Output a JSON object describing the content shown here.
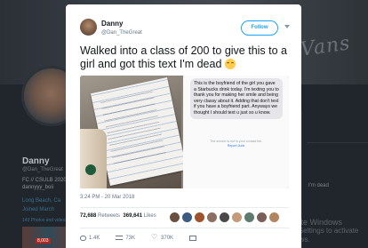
{
  "background_profile": {
    "banner_text": "Vans",
    "name": "Danny",
    "handle": "@Dan_TheGreat",
    "bio": "FC // CSULB 2020 dannyyy_boii",
    "location": "Long Beach, Ca",
    "joined": "Joined March",
    "photos_label": "143 Photos and videos",
    "thumb_badge": "8,003",
    "right_snippet": "I'm dead"
  },
  "watermark": {
    "line1": "Activate Windows",
    "line2": "Go to Settings to activate Windows."
  },
  "tweet": {
    "author_name": "Danny",
    "author_handle": "@Dan_TheGreat",
    "follow_label": "Follow",
    "text": "Walked into a class of 200 to give this to a girl and got this text I'm dead",
    "sms_message": "This is the boyfriend of the girl you gave a Starbucks drink today. I'm texting you to thank you for making her smile and being very classy about it. Adding that don't text if you have a boyfriend part. Anyways we thought I should text u just so u know.",
    "sms_footer": "The sender is not in your contact list.",
    "sms_link": "Report Junk",
    "timestamp": "3:24 PM - 20 Mar 2018",
    "retweets_count": "72,688",
    "retweets_label": "Retweets",
    "likes_count": "369,641",
    "likes_label": "Likes",
    "reply_count": "1.4K",
    "retweet_action_count": "73K",
    "like_action_count": "370K"
  },
  "colors": {
    "accent": "#1da1f2",
    "muted": "#657786",
    "text": "#14171a"
  }
}
